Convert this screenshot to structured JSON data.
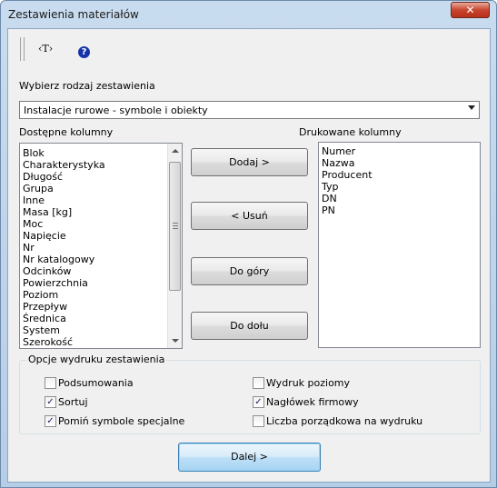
{
  "window": {
    "title": "Zestawienia materiałów",
    "close_glyph": "✕"
  },
  "toolbar": {
    "t_glyph": "‹T›",
    "help_glyph": "?"
  },
  "report_type": {
    "label": "Wybierz rodzaj zestawienia",
    "selected": "Instalacje rurowe - symbole i obiekty"
  },
  "available": {
    "label": "Dostępne kolumny",
    "items": [
      "Blok",
      "Charakterystyka",
      "Długość",
      "Grupa",
      "Inne",
      "Masa [kg]",
      "Moc",
      "Napięcie",
      "Nr",
      "Nr katalogowy",
      "Odcinków",
      "Powierzchnia",
      "Poziom",
      "Przepływ",
      "Średnica",
      "System",
      "Szerokość"
    ]
  },
  "printed": {
    "label": "Drukowane kolumny",
    "items": [
      "Numer",
      "Nazwa",
      "Producent",
      "Typ",
      "DN",
      "PN"
    ]
  },
  "buttons": {
    "add": "Dodaj >",
    "remove": "< Usuń",
    "up": "Do góry",
    "down": "Do dołu",
    "next": "Dalej >"
  },
  "options": {
    "title": "Opcje wydruku zestawienia",
    "items": [
      {
        "label": "Podsumowania",
        "checked": false
      },
      {
        "label": "Sortuj",
        "checked": true
      },
      {
        "label": "Pomiń symbole specjalne",
        "checked": true
      },
      {
        "label": "Wydruk poziomy",
        "checked": false
      },
      {
        "label": "Nagłówek firmowy",
        "checked": true
      },
      {
        "label": "Liczba porządkowa na wydruku",
        "checked": false
      }
    ]
  },
  "colors": {
    "title_bar": "#c9dcef",
    "close": "#c7452f",
    "default_button": "#bee0f7"
  },
  "icons": {
    "separator": "toolbar-grip-icon",
    "text": "text-tool-icon",
    "help": "help-icon"
  }
}
